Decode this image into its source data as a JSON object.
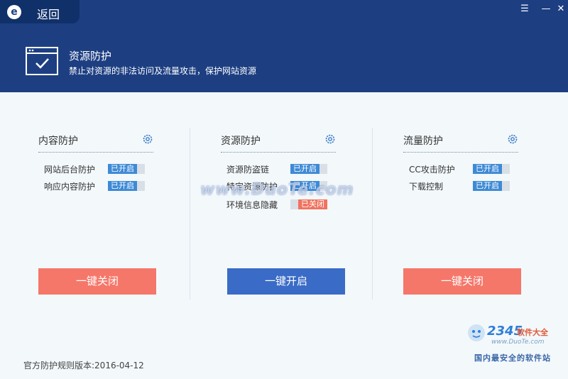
{
  "window": {
    "back_label": "返回",
    "logo_letter": "e",
    "menu_icon": "menu-icon",
    "minimize_icon": "minimize-icon",
    "close_icon": "close-icon"
  },
  "header": {
    "title": "资源防护",
    "description": "禁止对资源的非法访问及流量攻击，保护网站资源",
    "icon": "browser-check-icon"
  },
  "panels": [
    {
      "title": "内容防护",
      "settings_icon": "gear-icon",
      "items": [
        {
          "label": "网站后台防护",
          "status": "已开启",
          "on": true
        },
        {
          "label": "响应内容防护",
          "status": "已开启",
          "on": true
        }
      ],
      "button_label": "一键关闭",
      "button_color": "#f5776a"
    },
    {
      "title": "资源防护",
      "settings_icon": "gear-icon",
      "items": [
        {
          "label": "资源防盗链",
          "status": "已开启",
          "on": true
        },
        {
          "label": "特定资源防护",
          "status": "已开启",
          "on": true
        },
        {
          "label": "环境信息隐藏",
          "status": "已关闭",
          "on": false
        }
      ],
      "button_label": "一键开启",
      "button_color": "#3a6bc6"
    },
    {
      "title": "流量防护",
      "settings_icon": "gear-icon",
      "items": [
        {
          "label": "CC攻击防护",
          "status": "已开启",
          "on": true
        },
        {
          "label": "下载控制",
          "status": "已开启",
          "on": true
        }
      ],
      "button_label": "一键关闭",
      "button_color": "#f5776a"
    }
  ],
  "footer": {
    "version_text": "官方防护规则版本:2016-04-12"
  },
  "watermark": {
    "text": "www.DuoTe.com"
  },
  "brand": {
    "number": "2345",
    "name": "软件大全",
    "url": "www.DuoTe.com",
    "slogan": "国内最安全的软件站"
  },
  "colors": {
    "header_bg": "#1d3f82",
    "on": "#3e8ad6",
    "off": "#f0735f"
  }
}
